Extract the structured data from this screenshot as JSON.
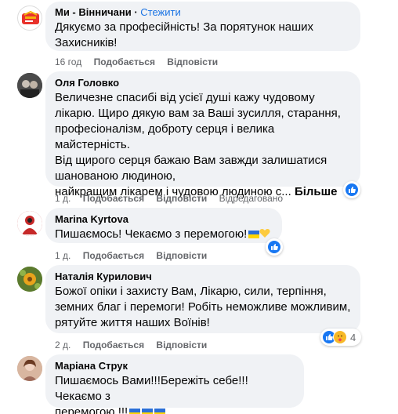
{
  "comments": [
    {
      "author": "Ми - Вінничани",
      "follow": "Стежити",
      "text": "Дякуємо за професійність! За порятунок наших\nЗахисників!",
      "time": "16 год",
      "like": "Подобається",
      "reply": "Відповісти"
    },
    {
      "author": "Оля Головко",
      "text": "Величезне спасибі від усієї душі кажу чудовому\nлікарю. Щиро дякую вам за Ваші зусилля, старання,\nпрофесіоналізм, доброту серця і велика майстерність.\nВід щирого серця бажаю Вам завжди залишатися\nшанованою людиною,\nнайкращим лікарем і чудовою людиною с... ",
      "more": "Більше",
      "time": "1 д.",
      "like": "Подобається",
      "reply": "Відповісти",
      "edited": "Відредаговано"
    },
    {
      "author": "Marina Kyrtova",
      "text": "Пишаємось! Чекаємо з перемогою!",
      "time": "1 д.",
      "like": "Подобається",
      "reply": "Відповісти"
    },
    {
      "author": "Наталія Курилович",
      "text": "Божої опіки і захисту Вам, Лікарю, сили, терпіння,\nземних благ і перемоги! Робіть неможливе можливим,\nрятуйте життя наших Воїнів!",
      "time": "2 д.",
      "like": "Подобається",
      "reply": "Відповісти",
      "reaction_count": "4"
    },
    {
      "author": "Маріана Струк",
      "text": "Пишаємось Вами!!!Бережіть себе!!!Чекаємо з\nперемогою !!!"
    }
  ],
  "icons": {
    "like": "thumbs-up-icon",
    "care": "care-icon",
    "flag": "ukraine-flag-icon",
    "heart": "yellow-heart-icon"
  },
  "colors": {
    "link": "#1b74e4",
    "like_blue": "#1877f2",
    "bubble": "#f0f2f5",
    "meta": "#65676b"
  }
}
